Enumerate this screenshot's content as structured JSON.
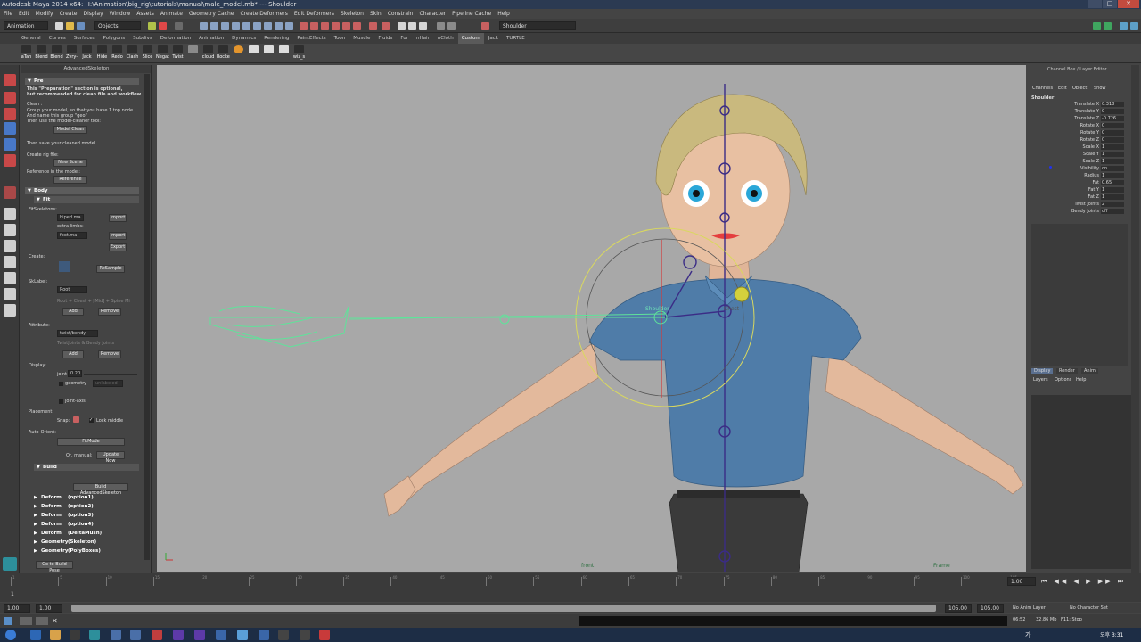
{
  "title": "Autodesk Maya 2014 x64: H:\\Animation\\big_rig\\tutorials\\manual\\male_model.mb* --- Shoulder",
  "menubar": [
    "File",
    "Edit",
    "Modify",
    "Create",
    "Display",
    "Window",
    "Assets",
    "Animate",
    "Geometry Cache",
    "Create Deformers",
    "Edit Deformers",
    "Skeleton",
    "Skin",
    "Constrain",
    "Character",
    "Pipeline Cache",
    "Help"
  ],
  "status": {
    "mode": "Animation",
    "objects_label": "Objects",
    "selection_field": "Shoulder"
  },
  "shelf_tabs": [
    "General",
    "Curves",
    "Surfaces",
    "Polygons",
    "Subdivs",
    "Deformation",
    "Animation",
    "Dynamics",
    "Rendering",
    "PaintEffects",
    "Toon",
    "Muscle",
    "Fluids",
    "Fur",
    "nHair",
    "nCloth",
    "Custom",
    "Jack",
    "TURTLE"
  ],
  "shelf_active": "Custom",
  "shelf_buttons": [
    "aTan",
    "Blend",
    "Blend",
    "Zvry-",
    "Jack",
    "Hide",
    "Redo",
    "Clash",
    "Slice",
    "Negat",
    "Twist",
    "",
    "cloud",
    "Rocket",
    "",
    "",
    "",
    "",
    "wiz_s"
  ],
  "panel": {
    "title": "AdvancedSkeleton",
    "pre": "Pre",
    "pre_note_1": "This \"Preparation\" section is optional,",
    "pre_note_2": "but recommended for clean file and workflow",
    "clean": "Clean :",
    "clean_1": "Group your model, so that you have 1 top node.",
    "clean_2": "And name this group \"geo\"",
    "clean_3": "Then use the model-cleaner tool:",
    "model_clean": "Model Clean",
    "save_note": "Then save your cleaned model.",
    "create_rig_file": "Create rig file:",
    "new_scene": "New Scene",
    "reference_note": "Reference in the model:",
    "reference": "Reference",
    "body": "Body",
    "fit": "Fit",
    "fit_skeleton": "FitSkeletons:",
    "biped": "biped.ma",
    "import": "Import",
    "extra_limbs": "extra limbs:",
    "foot": "foot.ma",
    "import2": "Import",
    "export": "Export",
    "create": "Create:",
    "resample": "ReSample",
    "skiplabel": "SkLabel:",
    "root": "Root",
    "root_hint": "Root + Chest + [Mid] + Spine Mi",
    "add": "Add",
    "remove": "Remove",
    "attribute": "Attribute:",
    "twist_bendy": "twist/bendy",
    "twist_hint": "TwistJoints & Bendy Joints",
    "add2": "Add",
    "remove2": "Remove",
    "display": "Display:",
    "joint_label": "joint",
    "joint_val": "0.20",
    "geometry": "geometry",
    "unlabeled": "unlabeled",
    "joint_axis": "joint-axis",
    "placement": "Placement:",
    "snap": "Snap:",
    "lock_middle": "Lock middle",
    "auto_orient": "Auto-Orient:",
    "fitmode": "FitMode",
    "or_manual": "Or, manual:",
    "update_now": "Update Now",
    "build": "Build",
    "build_btn": "Build AdvancedSkeleton",
    "deform_rows": [
      {
        "a": "Deform",
        "b": "(option1)"
      },
      {
        "a": "Deform",
        "b": "(option2)"
      },
      {
        "a": "Deform",
        "b": "(option3)"
      },
      {
        "a": "Deform",
        "b": "(option4)"
      },
      {
        "a": "Deform",
        "b": "(DeltaMush)"
      },
      {
        "a": "Geometry",
        "b": "(Skeleton)"
      },
      {
        "a": "Geometry",
        "b": "(PolyBoxes)"
      }
    ],
    "go_build_pose": "Go to Build Pose"
  },
  "viewport": {
    "menu": [
      "View",
      "Shading",
      "Lighting",
      "Show",
      "Renderer",
      "Panels"
    ],
    "label_front": "front",
    "label_frame": "Frame",
    "joint_shoulder": "Shoulder",
    "joint_chest": "Chest"
  },
  "channel_box": {
    "header": "Channel Box / Layer Editor",
    "tabs": [
      "Channels",
      "Edit",
      "Object",
      "Show"
    ],
    "object": "Shoulder",
    "channels": [
      {
        "n": "Translate X",
        "v": "0.318"
      },
      {
        "n": "Translate Y",
        "v": "0"
      },
      {
        "n": "Translate Z",
        "v": "-0.726"
      },
      {
        "n": "Rotate X",
        "v": "0"
      },
      {
        "n": "Rotate Y",
        "v": "0"
      },
      {
        "n": "Rotate Z",
        "v": "0"
      },
      {
        "n": "Scale X",
        "v": "1"
      },
      {
        "n": "Scale Y",
        "v": "1"
      },
      {
        "n": "Scale Z",
        "v": "1"
      },
      {
        "n": "Visibility",
        "v": "on"
      },
      {
        "n": "Radius",
        "v": "1"
      },
      {
        "n": "Fat",
        "v": "0.65"
      },
      {
        "n": "Fat Y",
        "v": "1"
      },
      {
        "n": "Fat Z",
        "v": "1"
      },
      {
        "n": "Twist Joints",
        "v": "2"
      },
      {
        "n": "Bendy Joints",
        "v": "off"
      }
    ],
    "layer_tabs": [
      "Display",
      "Render",
      "Anim"
    ],
    "layer_menu": [
      "Layers",
      "Options",
      "Help"
    ]
  },
  "timeline": {
    "current_frame": "1",
    "frame_field": "1.00",
    "range_start": "1.00",
    "range_inner_start": "1.00",
    "range_inner_end": "105.00",
    "range_end_a": "105.00",
    "range_end_b": "105.00",
    "anim_layer": "No Anim Layer",
    "char_set": "No Character Set",
    "ruler_ticks": [
      "1",
      "5",
      "10",
      "15",
      "20",
      "25",
      "30",
      "35",
      "40",
      "45",
      "50",
      "55",
      "60",
      "65",
      "70",
      "75",
      "80",
      "85",
      "90",
      "95",
      "100",
      "105"
    ]
  },
  "taskbar": {
    "status_1": "06:52",
    "status_2": "32.86 Mb",
    "status_3": "F11: Stop",
    "clock": "오후 3:31",
    "lang": "가"
  }
}
